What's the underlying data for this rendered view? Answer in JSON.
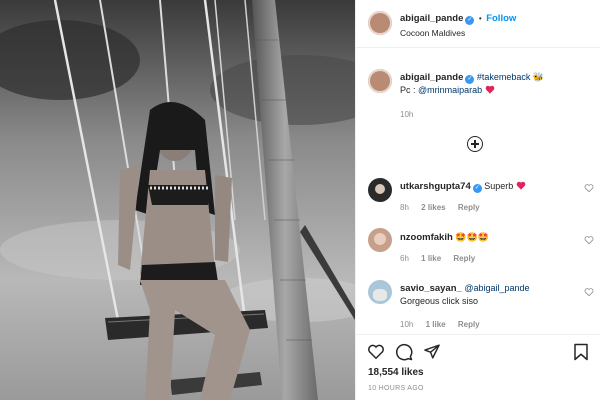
{
  "header": {
    "username": "abigail_pande",
    "dot": "•",
    "follow_label": "Follow",
    "location": "Cocoon Maldives"
  },
  "caption": {
    "username": "abigail_pande",
    "hashtag": "#takemeback",
    "emoji": "🐝",
    "line2_prefix": "Pc : ",
    "mention": "@mrinmaiparab",
    "time": "10h"
  },
  "comments": [
    {
      "username": "utkarshgupta74",
      "text": "Superb",
      "time": "8h",
      "likes": "2 likes",
      "reply": "Reply"
    },
    {
      "username": "nzoomfakih",
      "text": "🤩🤩🤩",
      "time": "6h",
      "likes": "1 like",
      "reply": "Reply"
    },
    {
      "username": "savio_sayan_",
      "mention": "@abigail_pande",
      "text": "Gorgeous click siso",
      "time": "10h",
      "likes": "1 like",
      "reply": "Reply"
    }
  ],
  "footer": {
    "likes_count": "18,554 likes",
    "time_ago": "10 HOURS AGO"
  },
  "colors": {
    "accent": "#0095f6",
    "verified": "#3897f0",
    "heart": "#ed4956",
    "muted": "#8e8e8e"
  },
  "icons": [
    "verified-icon",
    "bee-emoji",
    "heart-icon",
    "add-comment-icon",
    "like-icon",
    "comment-icon",
    "share-icon",
    "save-icon"
  ]
}
